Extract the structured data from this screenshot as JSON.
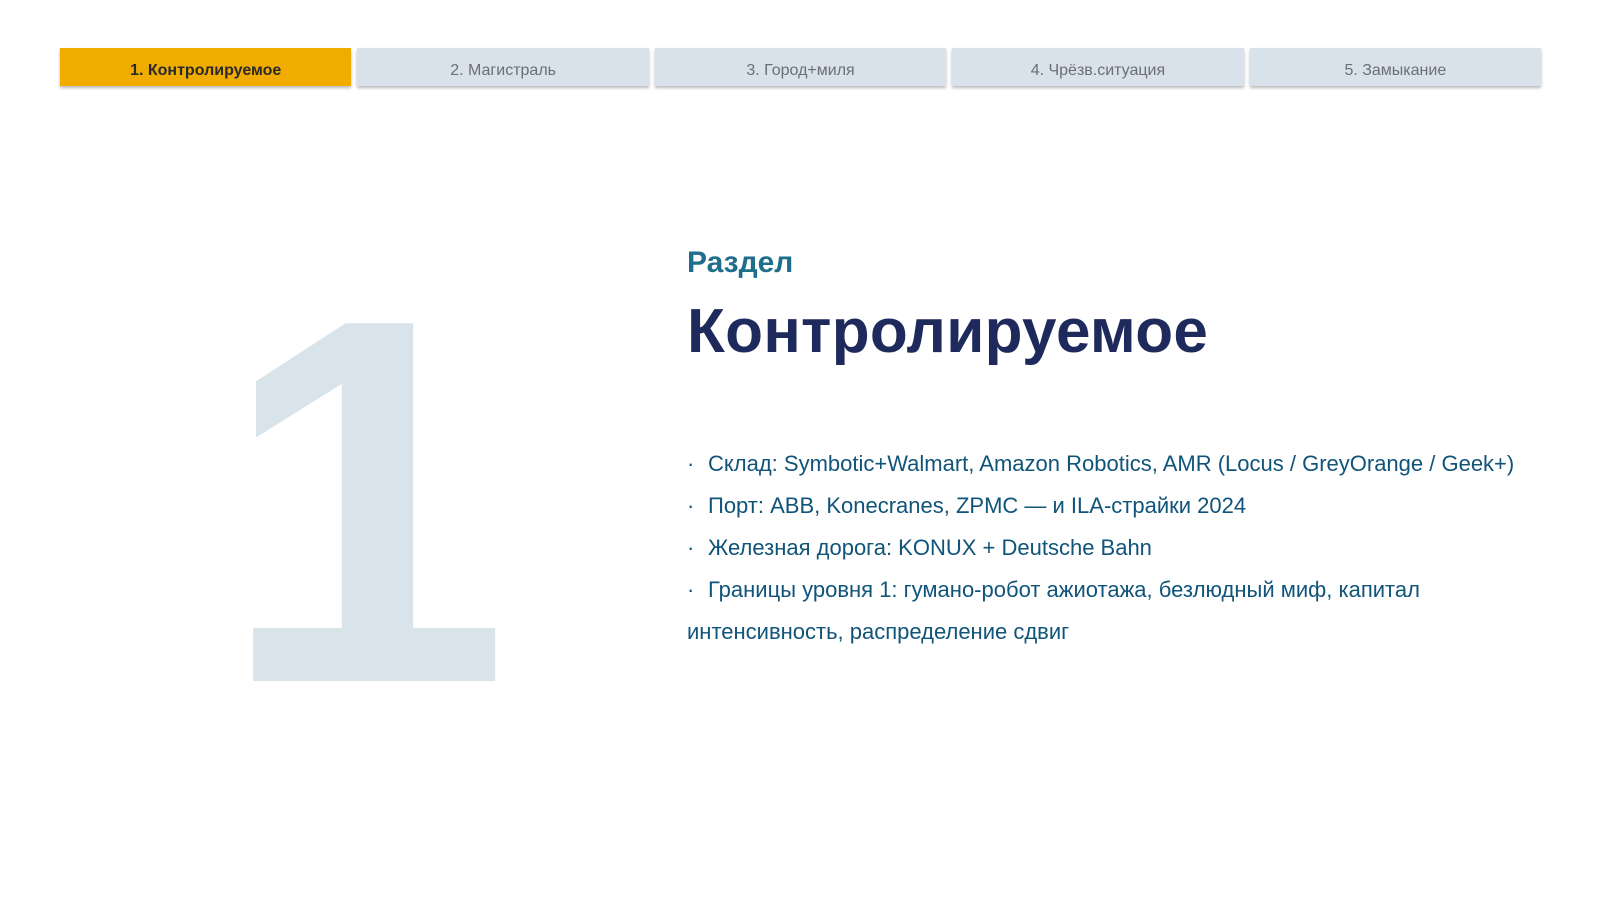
{
  "tabs": [
    {
      "label": "1. Контролируемое",
      "active": true
    },
    {
      "label": "2. Магистраль",
      "active": false
    },
    {
      "label": "3. Город+миля",
      "active": false
    },
    {
      "label": "4. Чрёзв.ситуация",
      "active": false
    },
    {
      "label": "5. Замыкание",
      "active": false
    }
  ],
  "section": {
    "number": "1",
    "label": "Раздел",
    "title": "Контролируемое",
    "bullet_symbol": "·",
    "bullets": [
      "Склад: Symbotic+Walmart, Amazon Robotics, AMR (Locus / GreyOrange / Geek+)",
      "Порт: ABB, Konecranes, ZPMC — и ILA-страйки 2024",
      "Железная дорога: KONUX + Deutsche Bahn",
      "Границы уровня 1: гумано-робот ажиотажа, безлюдный миф, капитал интенсивность, распределение сдвиг"
    ]
  },
  "colors": {
    "tab_active": "#f0ad00",
    "tab_inactive": "#d9e2ea",
    "big_number": "#d9e3ea",
    "label": "#1f6e8c",
    "title": "#1f2a5c",
    "bullet_text": "#10547a"
  }
}
